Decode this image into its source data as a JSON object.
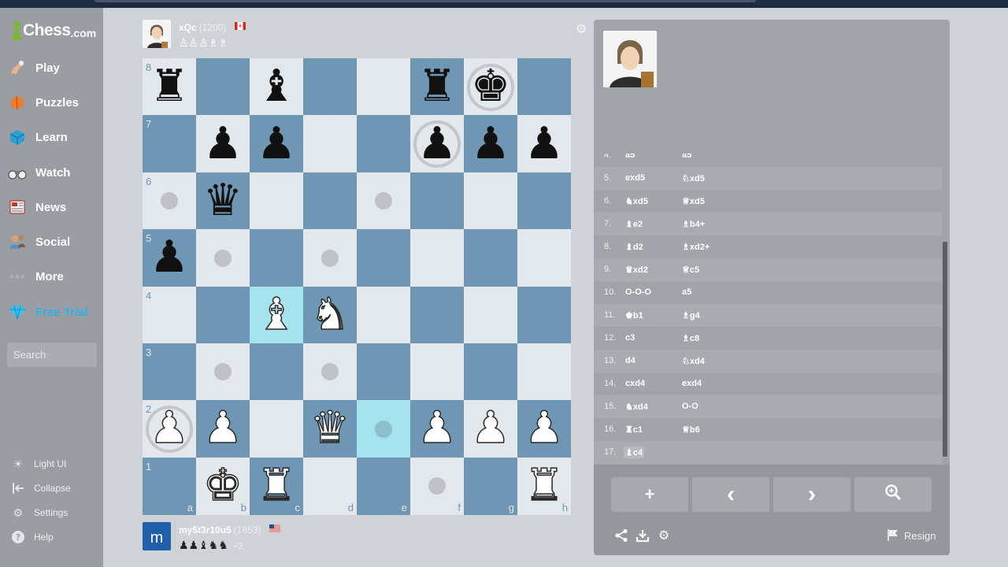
{
  "logo": {
    "word": "Chess",
    "dom": ".com"
  },
  "nav": [
    {
      "label": "Play",
      "icon": "play-hand-icon"
    },
    {
      "label": "Puzzles",
      "icon": "puzzle-icon"
    },
    {
      "label": "Learn",
      "icon": "learn-cube-icon"
    },
    {
      "label": "Watch",
      "icon": "binoculars-icon"
    },
    {
      "label": "News",
      "icon": "newspaper-icon"
    },
    {
      "label": "Social",
      "icon": "people-icon"
    },
    {
      "label": "More",
      "icon": "more-dots-icon"
    },
    {
      "label": "Free Trial",
      "icon": "diamond-icon"
    }
  ],
  "search": {
    "placeholder": "Search"
  },
  "footer": [
    {
      "label": "Light UI",
      "icon": "sun-icon"
    },
    {
      "label": "Collapse",
      "icon": "collapse-icon"
    },
    {
      "label": "Settings",
      "icon": "gear-icon"
    },
    {
      "label": "Help",
      "icon": "help-icon"
    }
  ],
  "top_player": {
    "name": "xQc",
    "rating": "(1200)",
    "flag": "canada",
    "captured": "♙♙♙♗♗"
  },
  "bottom_player": {
    "name": "my5t3r10u5",
    "rating": "(1653)",
    "flag": "usa",
    "captured": "♟♟♝♞♞",
    "advantage": "+2"
  },
  "board": {
    "ranks": [
      "8",
      "7",
      "6",
      "5",
      "4",
      "3",
      "2",
      "1"
    ],
    "files": [
      "a",
      "b",
      "c",
      "d",
      "e",
      "f",
      "g",
      "h"
    ],
    "colors": {
      "light": "#e3e8ec",
      "dark": "#6f97b3",
      "highlight": "#a6e3ef"
    },
    "pieces": [
      {
        "sq": "a8",
        "glyph": "♜",
        "side": "b"
      },
      {
        "sq": "c8",
        "glyph": "♝",
        "side": "b"
      },
      {
        "sq": "f8",
        "glyph": "♜",
        "side": "b"
      },
      {
        "sq": "g8",
        "glyph": "♚",
        "side": "b"
      },
      {
        "sq": "b7",
        "glyph": "♟",
        "side": "b"
      },
      {
        "sq": "c7",
        "glyph": "♟",
        "side": "b"
      },
      {
        "sq": "f7",
        "glyph": "♟",
        "side": "b"
      },
      {
        "sq": "g7",
        "glyph": "♟",
        "side": "b"
      },
      {
        "sq": "h7",
        "glyph": "♟",
        "side": "b"
      },
      {
        "sq": "b6",
        "glyph": "♛",
        "side": "b"
      },
      {
        "sq": "a5",
        "glyph": "♟",
        "side": "b"
      },
      {
        "sq": "c4",
        "glyph": "♝",
        "side": "w"
      },
      {
        "sq": "d4",
        "glyph": "♞",
        "side": "w"
      },
      {
        "sq": "d2",
        "glyph": "♛",
        "side": "w"
      },
      {
        "sq": "a2",
        "glyph": "♟",
        "side": "w"
      },
      {
        "sq": "b2",
        "glyph": "♟",
        "side": "w"
      },
      {
        "sq": "f2",
        "glyph": "♟",
        "side": "w"
      },
      {
        "sq": "g2",
        "glyph": "♟",
        "side": "w"
      },
      {
        "sq": "h2",
        "glyph": "♟",
        "side": "w"
      },
      {
        "sq": "b1",
        "glyph": "♚",
        "side": "w"
      },
      {
        "sq": "c1",
        "glyph": "♜",
        "side": "w"
      },
      {
        "sq": "h1",
        "glyph": "♜",
        "side": "w"
      }
    ],
    "highlights": [
      "c4",
      "e2"
    ],
    "dots": [
      "a6",
      "e6",
      "b5",
      "d5",
      "b3",
      "d3",
      "e2",
      "f1"
    ],
    "rings": [
      "g8",
      "f7",
      "a2"
    ]
  },
  "moves": [
    {
      "n": "4.",
      "w": "a5",
      "b": "a5"
    },
    {
      "n": "5.",
      "w": "exd5",
      "b": "♘xd5"
    },
    {
      "n": "6.",
      "w": "♞xd5",
      "b": "♕xd5"
    },
    {
      "n": "7.",
      "w": "♝e2",
      "b": "♗b4+"
    },
    {
      "n": "8.",
      "w": "♝d2",
      "b": "♗xd2+"
    },
    {
      "n": "9.",
      "w": "♛xd2",
      "b": "♕c5"
    },
    {
      "n": "10.",
      "w": "O-O-O",
      "b": "a5"
    },
    {
      "n": "11.",
      "w": "♚b1",
      "b": "♗g4"
    },
    {
      "n": "12.",
      "w": "c3",
      "b": "♗c8"
    },
    {
      "n": "13.",
      "w": "d4",
      "b": "♘xd4"
    },
    {
      "n": "14.",
      "w": "cxd4",
      "b": "exd4"
    },
    {
      "n": "15.",
      "w": "♞xd4",
      "b": "O-O"
    },
    {
      "n": "16.",
      "w": "♜c1",
      "b": "♕b6"
    },
    {
      "n": "17.",
      "w": "♝c4",
      "b": ""
    }
  ],
  "controls": {
    "add": "+",
    "prev": "‹",
    "next": "›",
    "resign": "Resign"
  }
}
